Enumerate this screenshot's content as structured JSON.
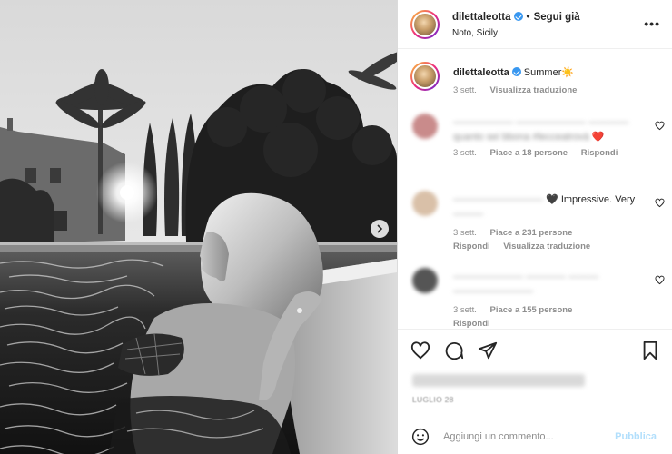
{
  "post": {
    "username": "dilettaleotta",
    "follow_state": "Segui già",
    "location": "Noto, Sicily",
    "more_icon": "more-horizontal-icon"
  },
  "caption": {
    "username": "dilettaleotta",
    "text": "Summer☀️",
    "time": "3 sett.",
    "translate": "Visualizza traduzione"
  },
  "comments": [
    {
      "line1": "—————— ——————— ———— ",
      "line2": "quanto sei bbona #lecceatrovà",
      "heart": "❤️",
      "time": "3 sett.",
      "likes": "Piace a 18 persone",
      "reply": "Rispondi"
    },
    {
      "blur_text": "—————————",
      "text": "🖤 Impressive. Very",
      "line2": "———",
      "time": "3 sett.",
      "likes": "Piace a 231 persone",
      "reply": "Rispondi",
      "translate": "Visualizza traduzione"
    },
    {
      "line1": "——————— ———— ———",
      "line2": "————————",
      "time": "3 sett.",
      "likes": "Piace a 155 persone",
      "reply": "Rispondi"
    }
  ],
  "actions": {
    "like_icon": "heart-icon",
    "comment_icon": "comment-icon",
    "share_icon": "send-icon",
    "save_icon": "bookmark-icon"
  },
  "date": "LUGLIO 28",
  "composer": {
    "placeholder": "Aggiungi un commento...",
    "publish": "Pubblica",
    "emoji_icon": "emoji-icon"
  },
  "colors": {
    "verified": "#3897f0",
    "publish": "#b2dffc",
    "heart": "#ed4956",
    "secondary_text": "#8e8e8e"
  }
}
